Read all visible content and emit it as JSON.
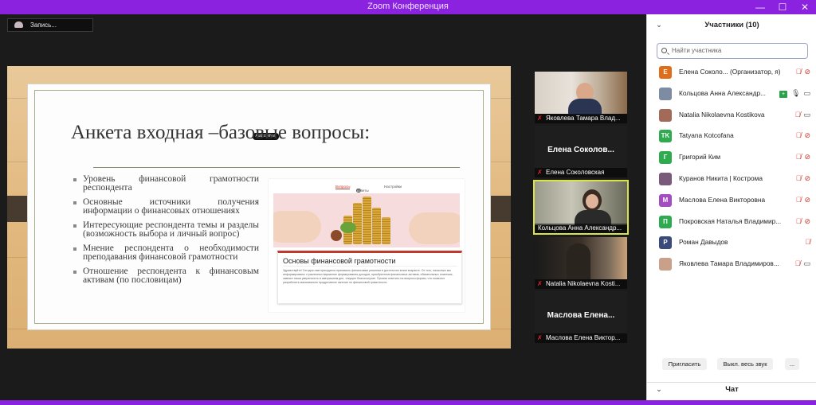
{
  "window": {
    "title": "Zoom Конференция"
  },
  "recording": {
    "label": "Запись..."
  },
  "slide": {
    "presenter_chip": "AudioSmart",
    "title": "Анкета входная –базовые вопросы:",
    "bullets": [
      "Уровень финансовой грамотности респондента",
      "Основные источники получения информации о финансовых отношениях",
      "Интересующие респондента темы и разделы (возможность выбора и личный вопрос)",
      "Мнение респондента о необходимости преподавания финансовой грамотности",
      "Отношение респондента к финансовым активам (по пословицам)"
    ],
    "form": {
      "tabs": [
        "Вопросы",
        "Ответы",
        "Настройки"
      ],
      "answers_badge": "83",
      "card_title": "Основы финансовой грамотности",
      "card_text": "Здравствуйте! Сегодня нам приходится принимать финансовые решения в достаточно юном возрасте. От того, насколько мы информированы о различных вариантах формирования доходов, приобретения финансовых активов, обязательных платежах, зависит наша уверенность в завтрашнем дне, текущее благополучие. Просим ответить на вопросы формы, что позволит разработать максимально продуктивное занятие по финансовой грамотности."
    }
  },
  "gallery": [
    {
      "caption": "Яковлева Тамара Влад...",
      "big_name": ""
    },
    {
      "caption": "Елена Соколовская",
      "big_name": "Елена Соколов..."
    },
    {
      "caption": "Кольцова Анна Александр...",
      "big_name": ""
    },
    {
      "caption": "Natalia Nikolaevna Kosti...",
      "big_name": ""
    },
    {
      "caption": "Маслова Елена Виктор...",
      "big_name": "Маслова Елена..."
    }
  ],
  "participants_panel": {
    "title": "Участники (10)",
    "search_placeholder": "Найти участника",
    "participants": [
      {
        "initials": "Е",
        "color": "#e06d1a",
        "name": "Елена Соколо...  (Организатор, я)",
        "mic": "off",
        "cam": "off",
        "host": false
      },
      {
        "initials": "",
        "color": "#7d8ca3",
        "name": "Кольцова Анна Александр...",
        "mic": "on",
        "cam": "on",
        "host": true
      },
      {
        "initials": "",
        "color": "#a36a5a",
        "name": "Natalia Nikolaevna Kostikova",
        "mic": "off",
        "cam": "on",
        "host": false
      },
      {
        "initials": "TK",
        "color": "#2eaa4f",
        "name": "Tatyana Kotcofana",
        "mic": "off",
        "cam": "off",
        "host": false
      },
      {
        "initials": "Г",
        "color": "#2eaa4f",
        "name": "Григорий Ким",
        "mic": "off",
        "cam": "off",
        "host": false
      },
      {
        "initials": "",
        "color": "#7a5a7a",
        "name": "Куранов Никита | Кострома",
        "mic": "off",
        "cam": "off",
        "host": false
      },
      {
        "initials": "М",
        "color": "#a24dc0",
        "name": "Маслова Елена Викторовна",
        "mic": "off",
        "cam": "off",
        "host": false
      },
      {
        "initials": "П",
        "color": "#2eaa4f",
        "name": "Покровская Наталья Владимир...",
        "mic": "off",
        "cam": "off",
        "host": false
      },
      {
        "initials": "Р",
        "color": "#3a4a7a",
        "name": "Роман Давыдов",
        "mic": "off",
        "cam": "",
        "host": false
      },
      {
        "initials": "",
        "color": "#c9a08a",
        "name": "Яковлева Тамара Владимиров...",
        "mic": "off",
        "cam": "on",
        "host": false
      }
    ],
    "invite_label": "Пригласить",
    "mute_all_label": "Выкл. весь звук",
    "more_label": "...",
    "chat_label": "Чат"
  }
}
